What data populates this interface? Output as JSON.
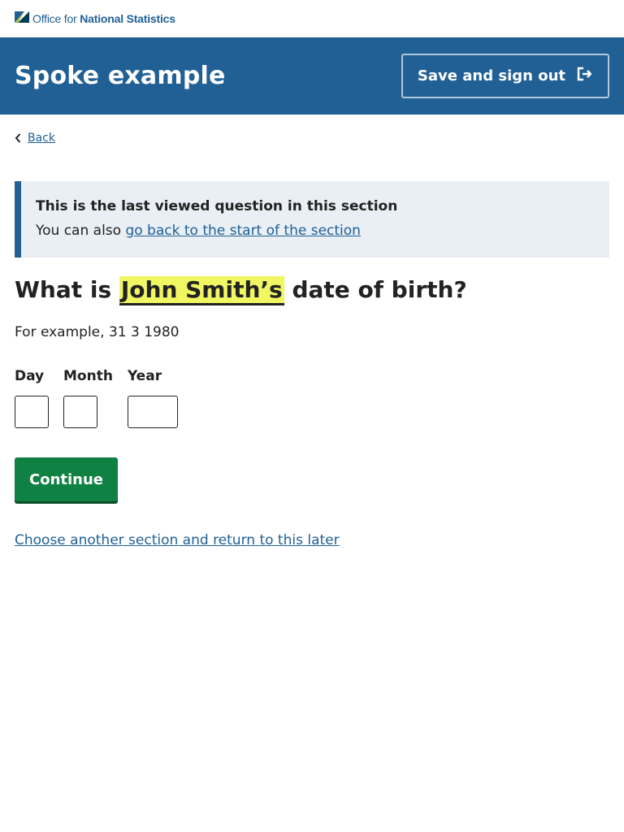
{
  "masthead": {
    "logo_prefix": "Office for",
    "logo_name": "National Statistics",
    "logo_color": "#206095"
  },
  "header": {
    "title": "Spoke example",
    "save_signout_label": "Save and sign out",
    "background": "#206095"
  },
  "nav": {
    "back_label": "Back"
  },
  "panel": {
    "title": "This is the last viewed question in this section",
    "body_prefix": "You can also",
    "link_text": "go back to the start of the section"
  },
  "question": {
    "prefix": "What is",
    "highlighted": "John Smith’s",
    "suffix": "date of birth?",
    "hint": "For example, 31 3 1980"
  },
  "date": {
    "day_label": "Day",
    "month_label": "Month",
    "year_label": "Year",
    "day_value": "",
    "month_value": "",
    "year_value": ""
  },
  "actions": {
    "continue_label": "Continue",
    "continue_color": "#0f8243",
    "another_section_link": "Choose another section and return to this later"
  },
  "icons": {
    "logo": "ons-logo-icon",
    "signout": "sign-out-icon",
    "back": "chevron-left-icon"
  }
}
